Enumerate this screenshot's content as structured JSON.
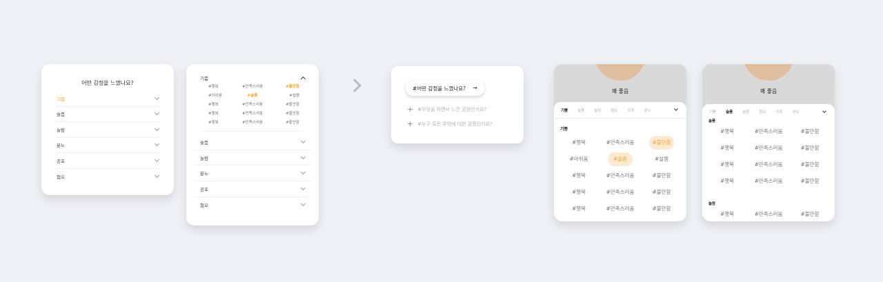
{
  "card1": {
    "title": "어떤 감정을 느꼈나요?",
    "rows": [
      "기쁨",
      "슬픔",
      "놀람",
      "분노",
      "공포",
      "혐오"
    ]
  },
  "card2": {
    "expanded": "기쁨",
    "tags": [
      [
        "#행복",
        "#만족스러움",
        "#불안함"
      ],
      [
        "#아쉬움",
        "#슬픔",
        "#설렘"
      ],
      [
        "#행복",
        "#만족스러움",
        "#불안함"
      ],
      [
        "#행복",
        "#만족스러움",
        "#불안함"
      ],
      [
        "#행복",
        "#만족스러움",
        "#불안함"
      ]
    ],
    "rows": [
      "슬픔",
      "놀람",
      "분노",
      "공포",
      "혐오"
    ]
  },
  "card3": {
    "pill": "#어떤 감정을 느꼈나요?",
    "pill_arrow": "→",
    "q1": "#무엇을 하면서 느낀 감정인가요?",
    "q2": "#누구 혹은 무엇에 대한 감정인가요?",
    "plus": "+"
  },
  "card4": {
    "title": "꽤 좋음",
    "tabs": [
      "기쁨",
      "슬픔",
      "놀람",
      "혐오",
      "공포",
      "분노"
    ],
    "section": "기쁨",
    "tags": [
      [
        "#행복",
        "#만족스러움",
        "#불안함"
      ],
      [
        "#아쉬움",
        "#슬픔",
        "#설렘"
      ],
      [
        "#행복",
        "#만족스러움",
        "#불안함"
      ],
      [
        "#행복",
        "#만족스러움",
        "#불안함"
      ],
      [
        "#행복",
        "#만족스러움",
        "#불안함"
      ]
    ]
  },
  "card5": {
    "title": "꽤 좋음",
    "tabs": [
      "기쁨",
      "슬픔",
      "놀람",
      "혐오",
      "공포",
      "분노"
    ],
    "section1": "슬픔",
    "section2": "놀람",
    "tags1": [
      [
        "#행복",
        "#만족스러움",
        "#불안함"
      ],
      [
        "#행복",
        "#만족스러움",
        "#불안함"
      ],
      [
        "#행복",
        "#만족스러움",
        "#불안함"
      ],
      [
        "#행복",
        "#만족스러움",
        "#불안함"
      ]
    ],
    "tags2": [
      [
        "#행복",
        "#만족스러움",
        "#불안함"
      ]
    ]
  },
  "colors": {
    "accent": "#f0a530",
    "highlight_bg": "#fde9d2",
    "background": "#f0f1f6"
  }
}
